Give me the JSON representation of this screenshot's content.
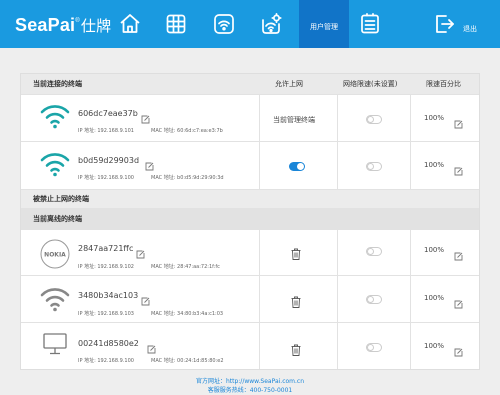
{
  "brand": {
    "name": "SeaPai",
    "registered": "®",
    "cn": "仕牌"
  },
  "nav": {
    "icons": [
      "home-icon",
      "grid-icon",
      "wifi-icon",
      "wifi-settings-icon",
      "user-management-icon",
      "list-icon"
    ],
    "active_label": "用户管理",
    "logout_label": "退出"
  },
  "table": {
    "headers": {
      "connected": "当前连接的终端",
      "allow": "允许上网",
      "limit": "网络限速(未设置)",
      "percent": "限速百分比"
    },
    "connected_devices": [
      {
        "name": "606dc7eae37b",
        "ip_label": "IP 地址:",
        "ip": "192.168.9.101",
        "mac_label": "MAC 地址:",
        "mac": "60:6d:c7:ea:e3:7b",
        "icon": "wifi-icon",
        "allow_text": "当前管理终端",
        "limit_on": false,
        "percent": "100%"
      },
      {
        "name": "b0d59d29903d",
        "ip_label": "IP 地址:",
        "ip": "192.168.9.100",
        "mac_label": "MAC 地址:",
        "mac": "b0:d5:9d:29:90:3d",
        "icon": "wifi-icon",
        "allow_on": true,
        "limit_on": false,
        "percent": "100%"
      }
    ],
    "blocked_section": "被禁止上网的终端",
    "offline_section": "当前离线的终端",
    "offline_devices": [
      {
        "name": "2847aa721ffc",
        "ip_label": "IP 地址:",
        "ip": "192.168.9.102",
        "mac_label": "MAC 地址:",
        "mac": "28:47:aa:72:1f:fc",
        "icon": "nokia-icon",
        "icon_text": "NOKIA",
        "limit_on": false,
        "percent": "100%"
      },
      {
        "name": "3480b34ac103",
        "ip_label": "IP 地址:",
        "ip": "192.168.9.103",
        "mac_label": "MAC 地址:",
        "mac": "34:80:b3:4a:c1:03",
        "icon": "wifi-gray-icon",
        "limit_on": false,
        "percent": "100%"
      },
      {
        "name": "00241d8580e2",
        "ip_label": "IP 地址:",
        "ip": "192.168.9.100",
        "mac_label": "MAC 地址:",
        "mac": "00:24:1d:85:80:e2",
        "icon": "monitor-icon",
        "limit_on": false,
        "percent": "100%"
      }
    ]
  },
  "footer": {
    "website": "官方网址：http://www.SeaPai.com.cn",
    "hotline": "客服服务热线：400-750-0001"
  },
  "colors": {
    "header": "#1a9ae0",
    "active_tab": "#1174c8",
    "toggle_on": "#1a86d8"
  }
}
